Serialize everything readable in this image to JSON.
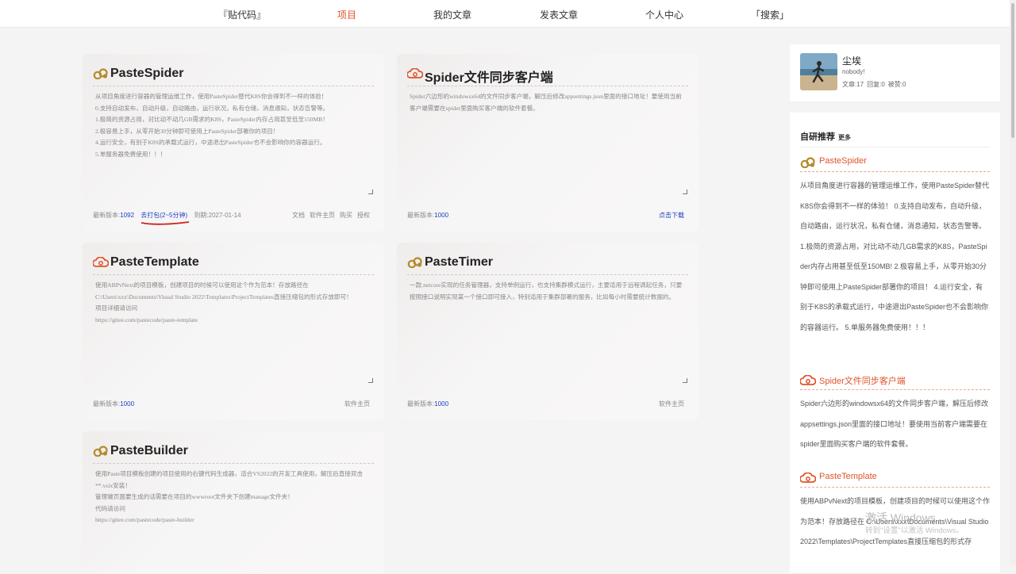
{
  "nav": {
    "items": [
      "『贴代码』",
      "项目",
      "我的文章",
      "发表文章",
      "个人中心",
      "「搜索」"
    ],
    "active_index": 1
  },
  "cards": [
    {
      "title": "PasteSpider",
      "icon": "gold-cloud-icon",
      "desc": "从项目角度进行容器的管理运维工作，使用PasteSpider替代K8S你会得到不一样的体验！\n0.支持自动发布，自动升级，自动路由，运行状况，私有仓储，消息通知，状态告警等。\n1.极简的资源占用，对比动不动几GB需求的K8S，PasteSpider内存占用甚至低至150MB！\n2.极容易上手，从零开始30分钟即可使用上PasteSpider部署你的项目！\n4.运行安全，有别于K8S的承载式运行，中途退出PasteSpider也不会影响你的容器运行。\n5.单服务器免费使用！！！",
      "version_label": "最新版本:",
      "version": "1092",
      "pack_label": "去打包(2~5分钟)",
      "expire_label": "到期:2027-01-14",
      "links": [
        "文档",
        "软件主页",
        "购买",
        "授权"
      ]
    },
    {
      "title": "Spider文件同步客户端",
      "icon": "red-cloud-icon",
      "desc": "Spider六边形的windowsx64的文件同步客户端，解压后修改appsettings.json里面的接口地址！要使用当前客户端需要在spider里面购买客户端的软件套餐。",
      "version_label": "最新版本:",
      "version": "1000",
      "links": [
        "点击下载"
      ]
    },
    {
      "title": "PasteTemplate",
      "icon": "red-cloud-icon",
      "desc": "使用ABPvNext的项目模板，创建项目的时候可以使用这个作为范本！存放路径在\nC:\\Users\\xxx\\Documents\\Visual Studio 2022\\Templates\\ProjectTemplates直接压缩包的形式存放即可！\n项目详细请访问\nhttps://gitee.com/pastecode/paste-template",
      "version_label": "最新版本:",
      "version": "1000",
      "links": [
        "软件主页"
      ]
    },
    {
      "title": "PasteTimer",
      "icon": "gold-cloud-icon",
      "desc": "一款.netcore实现的任务管理器，支持单例运行，也支持集群模式运行，主要适用于远程调起任务，只要按照接口说明实现某一个接口即可接入，特别适用于集群部署的服务，比如每小时需要统计数据的。",
      "version_label": "最新版本:",
      "version": "1000",
      "links": [
        "软件主页"
      ]
    },
    {
      "title": "PasteBuilder",
      "icon": "gold-cloud-icon",
      "desc": "使用Paste项目模板创建的项目使用的右键代码生成器，适合VS2022的开发工具使用，解压后直接双击**.vsix安装！\n管理端页面要生成的话需要在项目的wwwroot文件夹下创建manage文件夹！\n代码请访问\nhttps://gitee.com/pastecode/paste-builder"
    }
  ],
  "profile": {
    "name": "尘埃",
    "desc": "nobody!",
    "articles": "文章:17",
    "replies": "回复:0",
    "likes": "被赞:0"
  },
  "recommend": {
    "heading": "自研推荐",
    "more": "更多",
    "items": [
      {
        "title": "PasteSpider",
        "icon": "gold-cloud-icon",
        "text": "从项目角度进行容器的管理运维工作，使用PasteSpider替代K8S你会得到不一样的体验！ 0.支持自动发布，自动升级，自动路由，运行状况，私有仓储，消息通知，状态告警等。 1.极简的资源占用，对比动不动几GB需求的K8S，PasteSpider内存占用甚至低至150MB! 2.极容易上手，从零开始30分钟即可使用上PasteSpider部署你的项目！ 4.运行安全，有别于K8S的承载式运行，中途退出PasteSpider也不会影响你的容器运行。 5.单服务器免费使用！！！"
      },
      {
        "title": "Spider文件同步客户端",
        "icon": "red-cloud-icon",
        "text": "Spider六边形的windowsx64的文件同步客户端，解压后修改appsettings.json里面的接口地址！要使用当前客户端需要在spider里面购买客户端的软件套餐。"
      },
      {
        "title": "PasteTemplate",
        "icon": "red-cloud-icon",
        "text": "使用ABPvNext的项目模板，创建项目的时候可以使用这个作为范本！存放路径在 C:\\Users\\xxx\\Documents\\Visual Studio 2022\\Templates\\ProjectTemplates直接压缩包的形式存"
      }
    ]
  },
  "watermark": {
    "line1": "激活 Windows",
    "line2": "转到\"设置\"以激活 Windows。"
  },
  "colors": {
    "accent": "#e0542b",
    "link": "#1c3cc6",
    "gold": "#b58b2c",
    "red": "#e0542b"
  }
}
